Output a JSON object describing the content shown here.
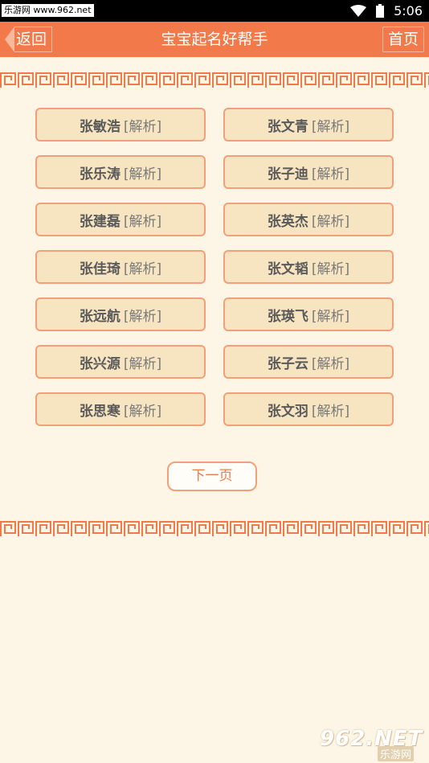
{
  "status_bar": {
    "watermark": "乐游网 www.962.net",
    "time": "5:06"
  },
  "header": {
    "back_label": "返回",
    "title": "宝宝起名好帮手",
    "home_label": "首页"
  },
  "names": [
    {
      "name": "张敏浩",
      "analysis": "[解析]"
    },
    {
      "name": "张文青",
      "analysis": "[解析]"
    },
    {
      "name": "张乐涛",
      "analysis": "[解析]"
    },
    {
      "name": "张子迪",
      "analysis": "[解析]"
    },
    {
      "name": "张建磊",
      "analysis": "[解析]"
    },
    {
      "name": "张英杰",
      "analysis": "[解析]"
    },
    {
      "name": "张佳琦",
      "analysis": "[解析]"
    },
    {
      "name": "张文韬",
      "analysis": "[解析]"
    },
    {
      "name": "张远航",
      "analysis": "[解析]"
    },
    {
      "name": "张瑛飞",
      "analysis": "[解析]"
    },
    {
      "name": "张兴源",
      "analysis": "[解析]"
    },
    {
      "name": "张子云",
      "analysis": "[解析]"
    },
    {
      "name": "张思寒",
      "analysis": "[解析]"
    },
    {
      "name": "张文羽",
      "analysis": "[解析]"
    }
  ],
  "pagination": {
    "next_label": "下一页"
  },
  "logo": {
    "main": "962.NET",
    "sub": "乐游网"
  },
  "colors": {
    "accent": "#f2794a",
    "background": "#fdf6e6",
    "button_fill": "#f7e4c0",
    "button_border": "#f3a07a"
  }
}
